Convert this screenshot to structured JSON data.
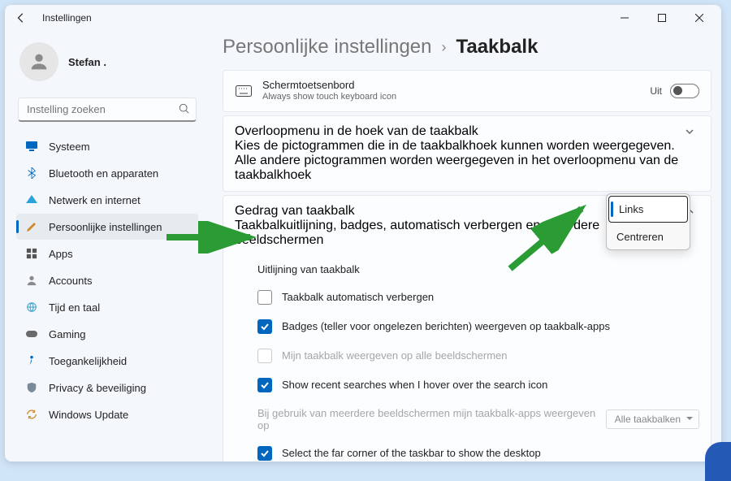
{
  "window": {
    "title": "Instellingen"
  },
  "user": {
    "name": "Stefan ."
  },
  "search": {
    "placeholder": "Instelling zoeken"
  },
  "nav": [
    {
      "label": "Systeem"
    },
    {
      "label": "Bluetooth en apparaten"
    },
    {
      "label": "Netwerk en internet"
    },
    {
      "label": "Persoonlijke instellingen"
    },
    {
      "label": "Apps"
    },
    {
      "label": "Accounts"
    },
    {
      "label": "Tijd en taal"
    },
    {
      "label": "Gaming"
    },
    {
      "label": "Toegankelijkheid"
    },
    {
      "label": "Privacy & beveiliging"
    },
    {
      "label": "Windows Update"
    }
  ],
  "breadcrumb": {
    "parent": "Persoonlijke instellingen",
    "current": "Taakbalk"
  },
  "panel_keyboard": {
    "title": "Schermtoetsenbord",
    "desc": "Always show touch keyboard icon",
    "status": "Uit"
  },
  "panel_overflow": {
    "title": "Overloopmenu in de hoek van de taakbalk",
    "desc": "Kies de pictogrammen die in de taakbalkhoek kunnen worden weergegeven. Alle andere pictogrammen worden weergegeven in het overloopmenu van de taakbalkhoek"
  },
  "panel_behavior": {
    "title": "Gedrag van taakbalk",
    "desc": "Taakbalkuitlijning, badges, automatisch verbergen en meerdere beeldschermen"
  },
  "opts": {
    "alignment": "Uitlijning van taakbalk",
    "autohide": "Taakbalk automatisch verbergen",
    "badges": "Badges (teller voor ongelezen berichten) weergeven op taakbalk-apps",
    "multimon": "Mijn taakbalk weergeven op alle beeldschermen",
    "recent": "Show recent searches when I hover over the search icon",
    "multimon_apps": "Bij gebruik van meerdere beeldschermen mijn taakbalk-apps weergeven op",
    "multimon_dd": "Alle taakbalken",
    "corner": "Select the far corner of the taskbar to show the desktop"
  },
  "popup": {
    "item1": "Links",
    "item2": "Centreren"
  }
}
